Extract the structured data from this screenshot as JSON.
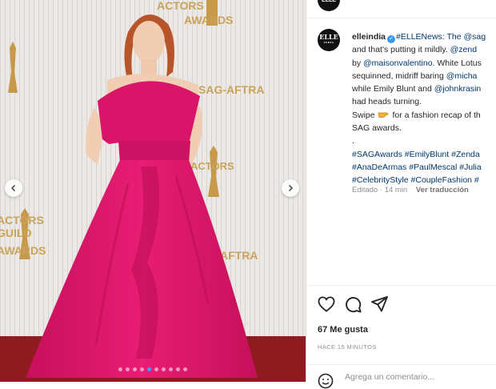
{
  "post_image": {
    "backdrop_text": [
      "ACTORS",
      "GUILD",
      "AWARDS",
      "SAG-AFTRA"
    ],
    "dress_color": "#e5186e",
    "carousel": {
      "total": 10,
      "active": 4
    }
  },
  "account": {
    "initials": "ELLE",
    "sub": "INDIA"
  },
  "caption": {
    "username": "elleindia",
    "lines": [
      [
        "#ELLENews: The ",
        "@sag"
      ],
      [
        "and that's putting it mildly. ",
        "@zend"
      ],
      [
        "by ",
        "@maisonvalentino",
        ". White Lotus"
      ],
      [
        "sequinned, midriff baring ",
        "@micha"
      ],
      [
        "while Emily Blunt and ",
        "@johnkrasin"
      ],
      [
        "had heads turning."
      ],
      [
        "Swipe ",
        "for a fashion recap of th"
      ],
      [
        "SAG awards."
      ],
      [
        "."
      ],
      [
        "#SAGAwards #EmilyBlunt #Zenda"
      ],
      [
        "#AnaDeArmas #PaulMescal #Julia"
      ],
      [
        "#CelebrityStyle #CoupleFashion #"
      ]
    ],
    "edited": "Editado",
    "time": "14 min",
    "translate": "Ver traducción"
  },
  "likes": "67 Me gusta",
  "time_ago": "HACE 15 MINUTOS",
  "comment": {
    "placeholder": "Agrega un comentario..."
  },
  "icons": [
    "chevron-left-icon",
    "chevron-right-icon",
    "heart-icon",
    "comment-icon",
    "share-icon",
    "emoji-icon",
    "verified-icon",
    "pointing-hand-icon"
  ]
}
